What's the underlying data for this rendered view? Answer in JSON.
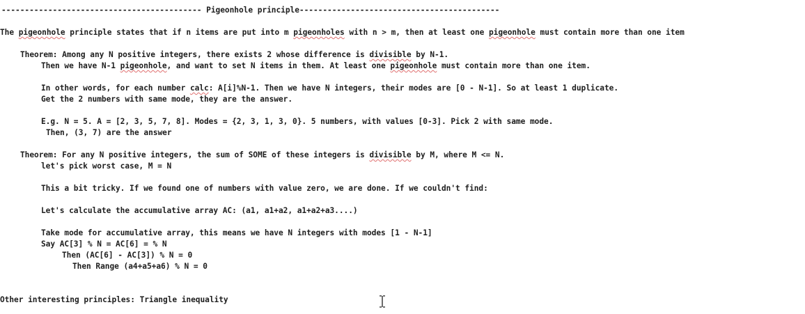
{
  "heading": {
    "dashes_left": "-------------------------------------------",
    "title": "Pigeonhole principle",
    "dashes_right": "-------------------------------------------"
  },
  "intro": {
    "p1": "The ",
    "w1": "pigeonhole",
    "p2": " principle states that if n items are put into m ",
    "w2": "pigeonholes",
    "p3": " with n > m, then at least one ",
    "w3": "pigeonhole",
    "p4": " must contain more than one item"
  },
  "theorem1": {
    "l1_a": "Theorem: Among any N positive integers, there exists 2 whose difference is ",
    "l1_w": "divisible",
    "l1_b": " by N-1.",
    "l2_a": "Then we have N-1 ",
    "l2_w": "pigeonhole",
    "l2_b": ", and want to set N items in them. At least one ",
    "l2_w2": "pigeonhole",
    "l2_c": " must contain more than one item.",
    "l3_a": "In other words, for each number ",
    "l3_w": "calc",
    "l3_b": ": A[i]%N-1. Then we have N integers, their modes are [0 - N-1]. So at least 1 duplicate.",
    "l4": "Get the 2 numbers with same mode, they are the answer.",
    "l5": "E.g. N = 5. A = [2, 3, 5, 7, 8]. Modes = {2, 3, 1, 3, 0}. 5 numbers, with values [0-3]. Pick 2 with same mode.",
    "l6": "Then, (3, 7) are the answer"
  },
  "theorem2": {
    "l1_a": "Theorem: For any N positive integers, the sum of SOME of these integers is ",
    "l1_w": "divisible",
    "l1_b": " by M, where M <= N.",
    "l2": "let's pick worst case, M = N",
    "l3": "This a bit tricky. If we found one of numbers with value zero, we are done. If we couldn't find:",
    "l4": "Let's calculate the accumulative array AC: (a1, a1+a2, a1+a2+a3....)",
    "l5": "Take mode for accumulative array, this means we have N integers with modes [1 - N-1]",
    "l6": "Say AC[3] % N = AC[6] = % N",
    "l7": "Then (AC[6] - AC[3]) % N = 0",
    "l8": "Then Range (a4+a5+a6) % N = 0"
  },
  "footer": {
    "other": "Other interesting principles: Triangle inequality"
  },
  "cursor_icon": "text-cursor-icon"
}
